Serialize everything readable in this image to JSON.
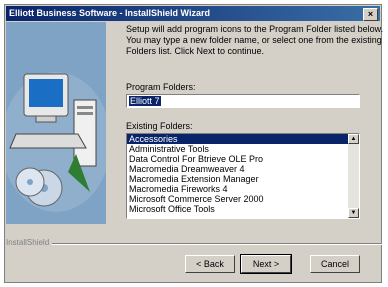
{
  "window": {
    "title": "Elliott Business Software - InstallShield Wizard",
    "close_glyph": "×"
  },
  "description": [
    "Setup will add program icons to the Program Folder listed below.",
    "You may type a new folder name, or select one from the existing",
    "Folders list.  Click Next to continue."
  ],
  "program_folders": {
    "label": "Program Folders:",
    "value": "Elliott 7"
  },
  "existing_folders": {
    "label": "Existing Folders:",
    "items": [
      "Accessories",
      "Administrative Tools",
      "Data Control For Btrieve OLE Pro",
      "Macromedia Dreamweaver 4",
      "Macromedia Extension Manager",
      "Macromedia Fireworks 4",
      "Microsoft Commerce Server 2000",
      "Microsoft Office Tools"
    ],
    "selected_index": 0
  },
  "footer": {
    "brand": "InstallShield"
  },
  "buttons": {
    "back": "< Back",
    "next": "Next >",
    "cancel": "Cancel"
  },
  "colors": {
    "titlebar": "#0a246a",
    "face": "#d4d0c8",
    "selection": "#0a246a"
  }
}
